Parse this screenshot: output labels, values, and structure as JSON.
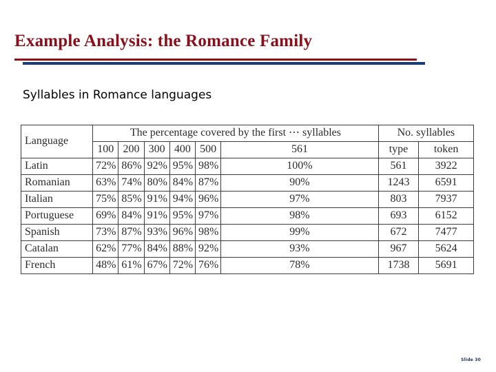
{
  "slide": {
    "title": "Example Analysis: the Romance Family",
    "subtitle": "Syllables in Romance languages",
    "slide_number_label": "Slide 30",
    "accent_red": "#8b1018",
    "accent_navy": "#1c3c74",
    "title_color": "#8b0f1a"
  },
  "table": {
    "header": {
      "language": "Language",
      "percentage_group": "The percentage covered by the first ⋯ syllables",
      "no_syllables_group": "No. syllables",
      "pct_columns": [
        "100",
        "200",
        "300",
        "400",
        "500",
        "561"
      ],
      "count_columns": [
        "type",
        "token"
      ]
    },
    "rows": [
      {
        "language": "Latin",
        "pct": [
          "72%",
          "86%",
          "92%",
          "95%",
          "98%",
          "100%"
        ],
        "type": "561",
        "token": "3922"
      },
      {
        "language": "Romanian",
        "pct": [
          "63%",
          "74%",
          "80%",
          "84%",
          "87%",
          "90%"
        ],
        "type": "1243",
        "token": "6591"
      },
      {
        "language": "Italian",
        "pct": [
          "75%",
          "85%",
          "91%",
          "94%",
          "96%",
          "97%"
        ],
        "type": "803",
        "token": "7937"
      },
      {
        "language": "Portuguese",
        "pct": [
          "69%",
          "84%",
          "91%",
          "95%",
          "97%",
          "98%"
        ],
        "type": "693",
        "token": "6152"
      },
      {
        "language": "Spanish",
        "pct": [
          "73%",
          "87%",
          "93%",
          "96%",
          "98%",
          "99%"
        ],
        "type": "672",
        "token": "7477"
      },
      {
        "language": "Catalan",
        "pct": [
          "62%",
          "77%",
          "84%",
          "88%",
          "92%",
          "93%"
        ],
        "type": "967",
        "token": "5624"
      },
      {
        "language": "French",
        "pct": [
          "48%",
          "61%",
          "67%",
          "72%",
          "76%",
          "78%"
        ],
        "type": "1738",
        "token": "5691"
      }
    ]
  }
}
